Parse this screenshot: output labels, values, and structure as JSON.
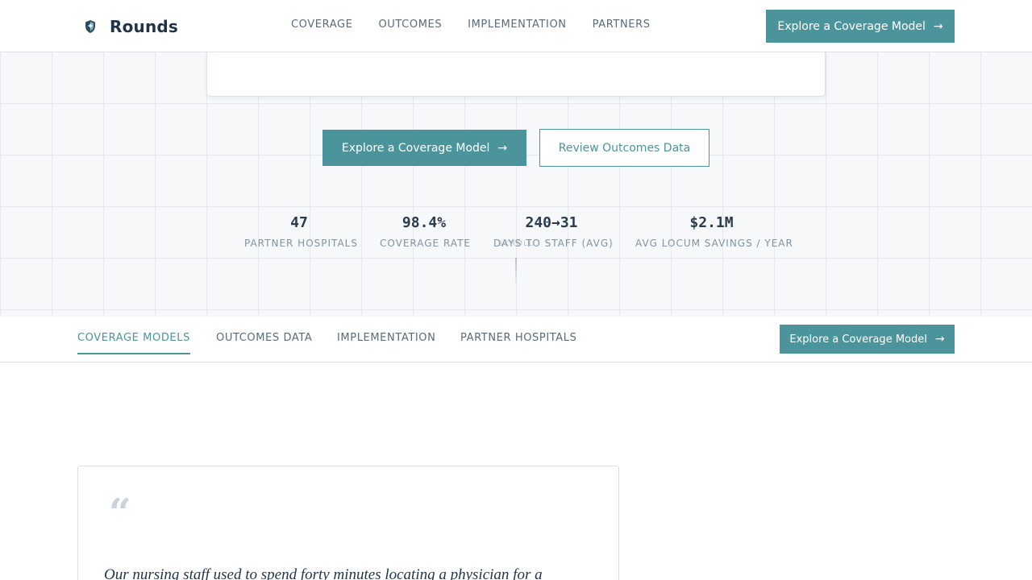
{
  "brand": {
    "name": "Rounds",
    "icon": "shield-icon"
  },
  "topnav": {
    "links": [
      "COVERAGE",
      "OUTCOMES",
      "IMPLEMENTATION",
      "PARTNERS"
    ],
    "cta_label": "Explore a Coverage Model"
  },
  "hero": {
    "primary_cta": "Explore a Coverage Model",
    "secondary_cta": "Review Outcomes Data",
    "stats": [
      {
        "value": "47",
        "label": "PARTNER HOSPITALS"
      },
      {
        "value": "98.4%",
        "label": "COVERAGE RATE"
      },
      {
        "value": "240→31",
        "label": "DAYS TO STAFF (AVG)"
      },
      {
        "value": "$2.1M",
        "label": "AVG LOCUM SAVINGS / YEAR"
      }
    ],
    "scroll_hint": "SCROLL"
  },
  "subnav": {
    "tabs": [
      "COVERAGE MODELS",
      "OUTCOMES DATA",
      "IMPLEMENTATION",
      "PARTNER HOSPITALS"
    ],
    "active_tab": "COVERAGE MODELS",
    "cta_label": "Explore a Coverage Model"
  },
  "testimonial": {
    "quote_mark": "“",
    "text": "Our nursing staff used to spend forty minutes locating a physician for a"
  },
  "colors": {
    "accent": "#4b949b",
    "text": "#1f3446",
    "muted": "#586b7b"
  }
}
